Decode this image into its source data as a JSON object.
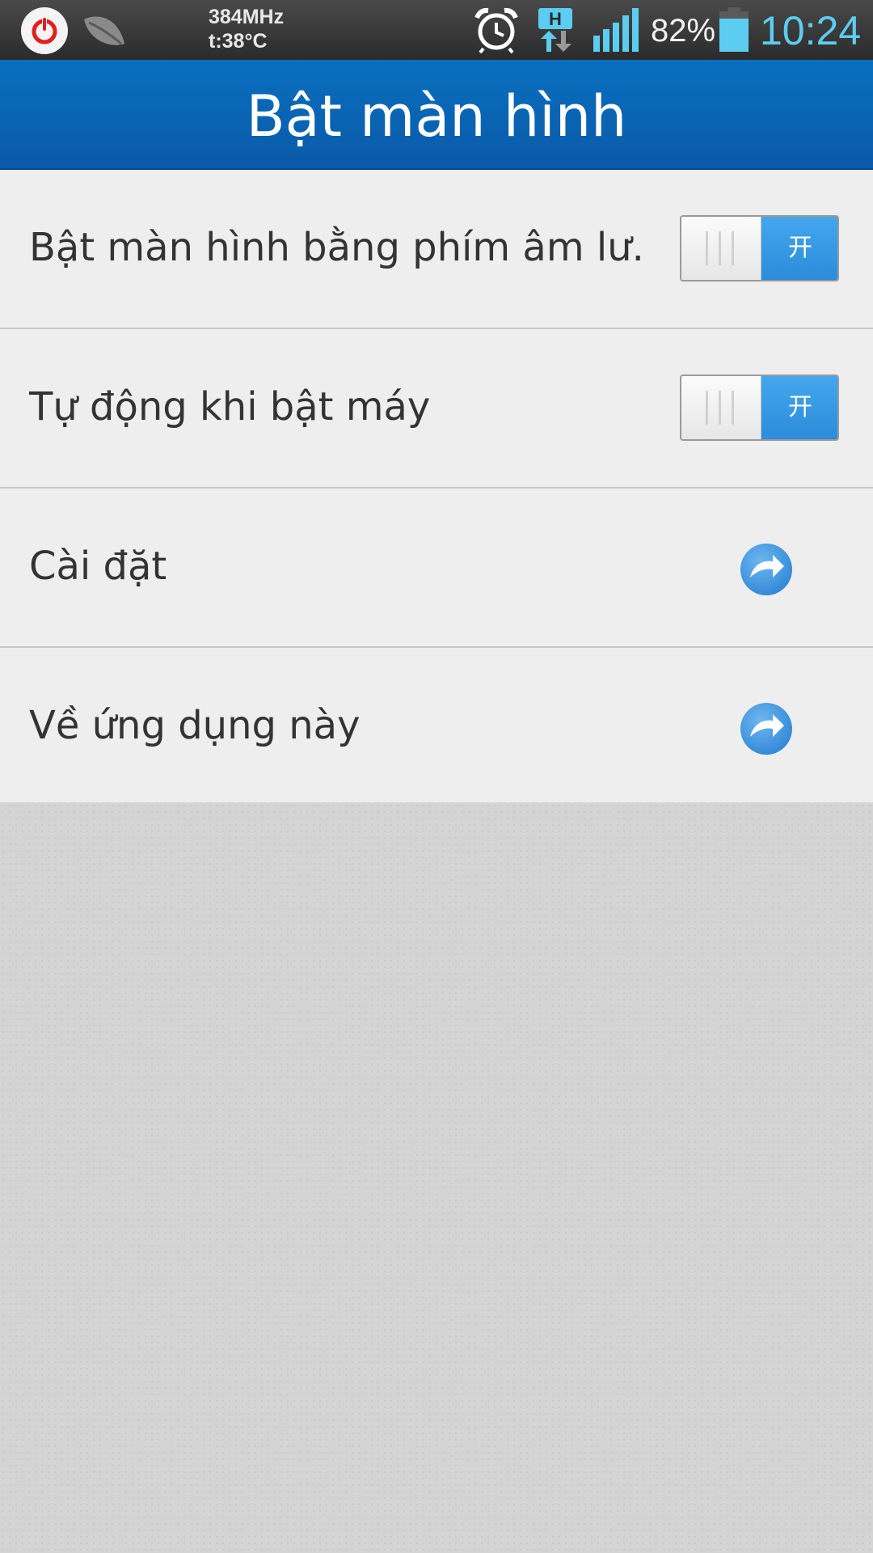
{
  "status_bar": {
    "cpu_freq": "384MHz",
    "temperature": "t:38°C",
    "battery_percent": "82%",
    "battery_level": 0.82,
    "clock": "10:24",
    "network_label": "H",
    "icons": [
      "power-icon",
      "leaf-icon",
      "alarm-clock-icon",
      "data-transfer-icon",
      "signal-icon",
      "battery-icon"
    ]
  },
  "header": {
    "title": "Bật màn hình"
  },
  "settings": {
    "items": [
      {
        "label": "Bật màn hình bằng phím âm lư...",
        "control": "toggle",
        "state": "on",
        "toggle_text": "开"
      },
      {
        "label": "Tự động khi bật máy",
        "control": "toggle",
        "state": "on",
        "toggle_text": "开"
      },
      {
        "label": "Cài đặt",
        "control": "arrow",
        "icon": "forward-arrow-icon"
      },
      {
        "label": "Về ứng dụng này",
        "control": "arrow",
        "icon": "forward-arrow-icon"
      }
    ]
  },
  "colors": {
    "header_blue": "#0a64b4",
    "toggle_on_blue": "#3a9ae6",
    "clock_cyan": "#5ccdf0",
    "power_red": "#e02020"
  }
}
